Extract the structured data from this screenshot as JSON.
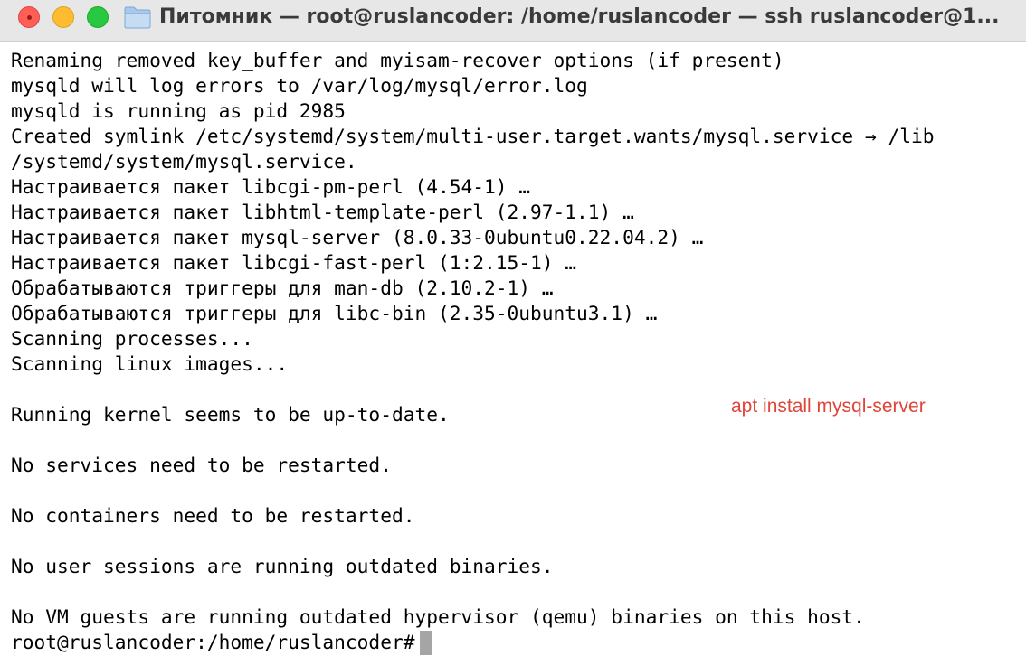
{
  "window": {
    "title": "Питомник — root@ruslancoder: /home/ruslancoder — ssh ruslancoder@1...",
    "title_icon": "folder-icon",
    "controls": [
      "close",
      "minimize",
      "maximize"
    ]
  },
  "terminal": {
    "lines": [
      "Renaming removed key_buffer and myisam-recover options (if present)",
      "mysqld will log errors to /var/log/mysql/error.log",
      "mysqld is running as pid 2985",
      "Created symlink /etc/systemd/system/multi-user.target.wants/mysql.service → /lib",
      "/systemd/system/mysql.service.",
      "Настраивается пакет libcgi-pm-perl (4.54-1) …",
      "Настраивается пакет libhtml-template-perl (2.97-1.1) …",
      "Настраивается пакет mysql-server (8.0.33-0ubuntu0.22.04.2) …",
      "Настраивается пакет libcgi-fast-perl (1:2.15-1) …",
      "Обрабатываются триггеры для man-db (2.10.2-1) …",
      "Обрабатываются триггеры для libc-bin (2.35-0ubuntu3.1) …",
      "Scanning processes...",
      "Scanning linux images...",
      "",
      "Running kernel seems to be up-to-date.",
      "",
      "No services need to be restarted.",
      "",
      "No containers need to be restarted.",
      "",
      "No user sessions are running outdated binaries.",
      "",
      "No VM guests are running outdated hypervisor (qemu) binaries on this host."
    ],
    "prompt": "root@ruslancoder:/home/ruslancoder#",
    "annotation": "apt install mysql-server"
  },
  "colors": {
    "titlebar": "#e7e7e7",
    "text": "#000000",
    "annotation": "#e0453a",
    "cursor": "#a5a5a5"
  }
}
